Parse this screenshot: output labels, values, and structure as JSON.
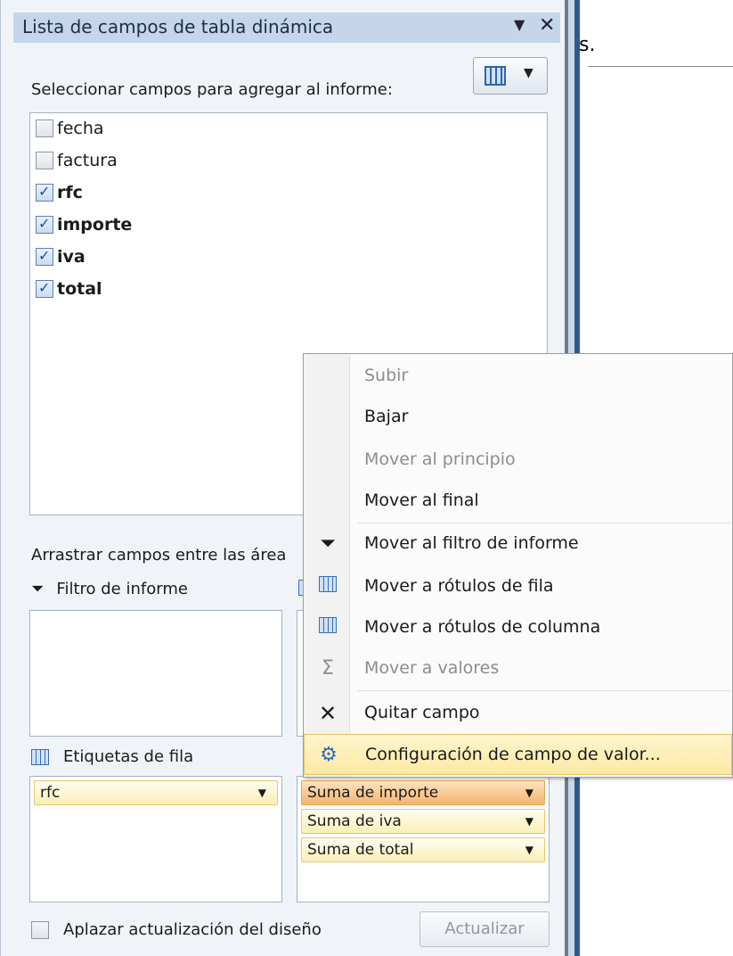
{
  "panel": {
    "title": "Lista de campos de tabla dinámica",
    "select_label": "Seleccionar campos para agregar al informe:",
    "drag_label": "Arrastrar campos entre las área",
    "fields": [
      {
        "label": "fecha",
        "checked": false
      },
      {
        "label": "factura",
        "checked": false
      },
      {
        "label": "rfc",
        "checked": true
      },
      {
        "label": "importe",
        "checked": true
      },
      {
        "label": "iva",
        "checked": true
      },
      {
        "label": "total",
        "checked": true
      }
    ],
    "areas": {
      "report_filter": "Filtro de informe",
      "row_labels": "Etiquetas de fila"
    },
    "row_items": [
      "rfc"
    ],
    "value_items": [
      "Suma de importe",
      "Suma de iva",
      "Suma de total"
    ],
    "defer_label": "Aplazar actualización del diseño",
    "update_label": "Actualizar"
  },
  "sheet": {
    "visible_text": "s."
  },
  "context_menu": {
    "items": [
      {
        "label": "Subir",
        "enabled": false
      },
      {
        "label": "Bajar",
        "enabled": true
      },
      {
        "label": "Mover al principio",
        "enabled": false
      },
      {
        "label": "Mover al final",
        "enabled": true
      },
      {
        "label": "Mover al filtro de informe",
        "enabled": true,
        "icon": "filter-icon"
      },
      {
        "label": "Mover a rótulos de fila",
        "enabled": true,
        "icon": "row-labels-icon"
      },
      {
        "label": "Mover a rótulos de columna",
        "enabled": true,
        "icon": "column-labels-icon"
      },
      {
        "label": "Mover a valores",
        "enabled": false,
        "icon": "sigma-icon"
      },
      {
        "label": "Quitar campo",
        "enabled": true,
        "icon": "remove-x-icon"
      },
      {
        "label": "Configuración de campo de valor...",
        "enabled": true,
        "icon": "field-settings-icon",
        "highlighted": true
      }
    ]
  },
  "colors": {
    "title_bar": "#c5d6ea",
    "pill": "#fbeeb7",
    "pill_selected": "#f6b36c",
    "menu_highlight": "#fde9a5"
  }
}
